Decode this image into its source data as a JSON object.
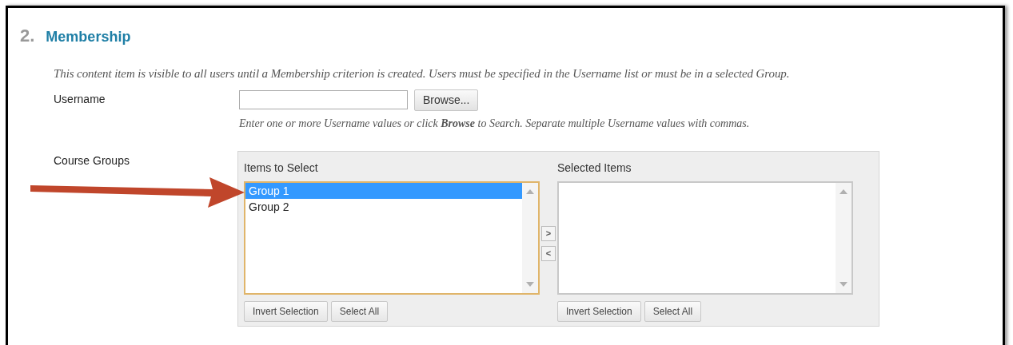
{
  "section": {
    "number": "2.",
    "title": "Membership"
  },
  "description": "This content item is visible to all users until a Membership criterion is created. Users must be specified in the Username list or must be in a selected Group.",
  "username": {
    "label": "Username",
    "button": "Browse...",
    "hint": "Enter one or more Username values or click **Browse** to Search. Separate multiple Username values with commas."
  },
  "course_groups": {
    "label": "Course Groups",
    "available": {
      "title": "Items to Select",
      "items": [
        {
          "label": "Group 1",
          "selected": true
        },
        {
          "label": "Group 2",
          "selected": false
        }
      ],
      "buttons": [
        "Invert Selection",
        "Select All"
      ]
    },
    "move_buttons": [
      ">",
      "<"
    ],
    "chosen": {
      "title": "Selected Items",
      "buttons": [
        "Invert Selection",
        "Select All"
      ]
    }
  }
}
